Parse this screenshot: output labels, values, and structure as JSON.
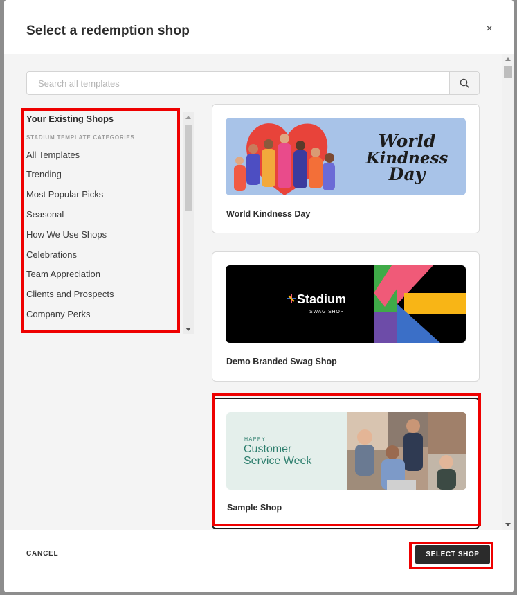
{
  "modal": {
    "title": "Select a redemption shop",
    "close_glyph": "×"
  },
  "search": {
    "placeholder": "Search all templates",
    "icon": "search-icon"
  },
  "sidebar": {
    "existing_label": "Your Existing Shops",
    "categories_header": "STADIUM TEMPLATE CATEGORIES",
    "items": [
      "All Templates",
      "Trending",
      "Most Popular Picks",
      "Seasonal",
      "How We Use Shops",
      "Celebrations",
      "Team Appreciation",
      "Clients and Prospects",
      "Company Perks"
    ]
  },
  "cards": [
    {
      "label": "World Kindness Day",
      "image_text": [
        "World",
        "Kindness",
        "Day"
      ]
    },
    {
      "label": "Demo Branded Swag Shop",
      "image_text": [
        "Stadium",
        "SWAG SHOP"
      ]
    },
    {
      "label": "Sample Shop",
      "image_text": [
        "HAPPY",
        "Customer",
        "Service Week"
      ],
      "selected": true
    }
  ],
  "footer": {
    "cancel_label": "CANCEL",
    "select_label": "SELECT SHOP"
  },
  "colors": {
    "highlight": "#ee0000",
    "primary_button": "#2b2b2b",
    "kindness_bg": "#a8c3e8",
    "csw_bg": "#e4efeb",
    "csw_text": "#2e7f6e"
  }
}
